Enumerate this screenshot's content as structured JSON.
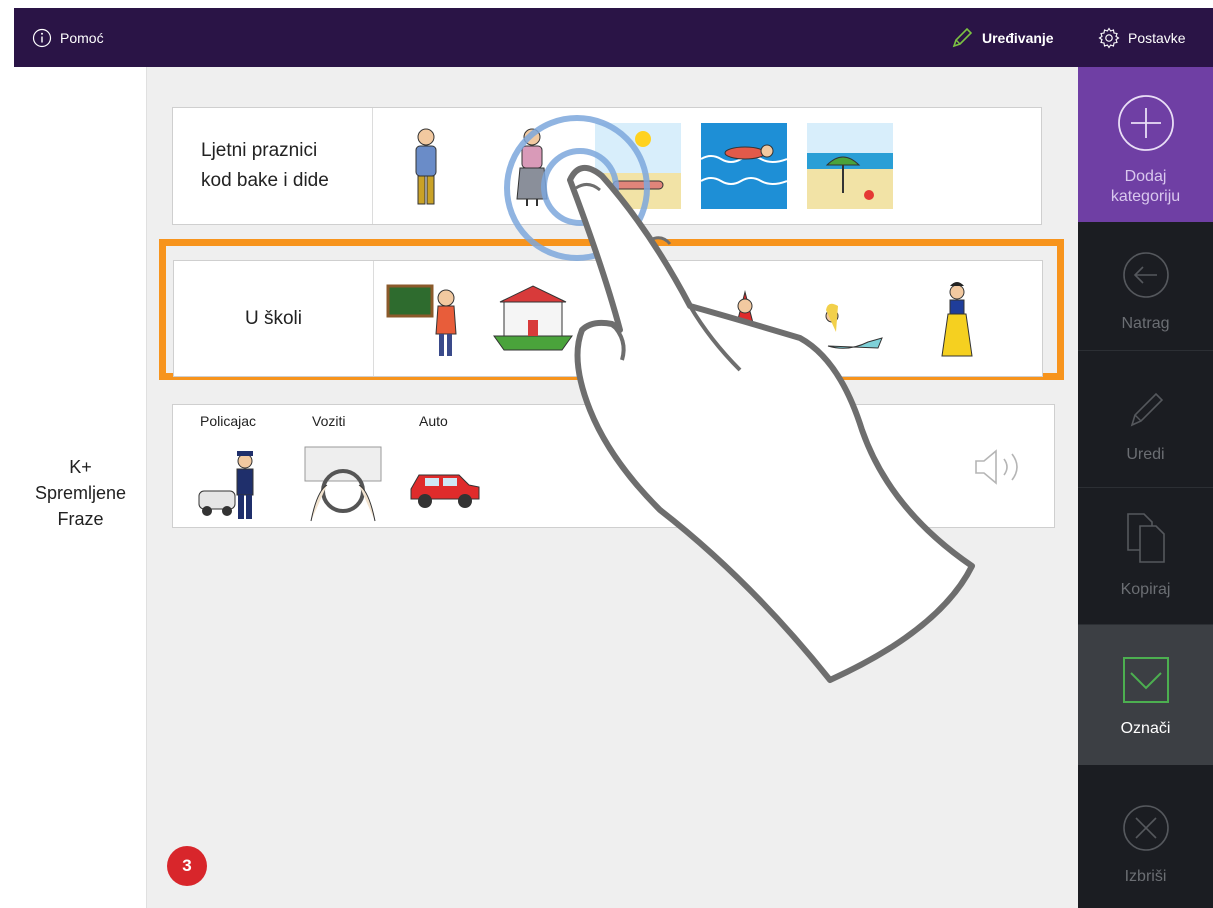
{
  "topbar": {
    "help_label": "Pomoć",
    "edit_label": "Uređivanje",
    "settings_label": "Postavke"
  },
  "left_panel": {
    "label_line1": "K+",
    "label_line2": "Spremljene",
    "label_line3": "Fraze"
  },
  "categories": [
    {
      "title_line1": "Ljetni praznici",
      "title_line2": "kod bake i dide",
      "pictograms": [
        "grandfather",
        "grandmother",
        "sunbathing",
        "swimming",
        "beach"
      ]
    },
    {
      "title": "U školi",
      "selected": true,
      "pictograms": [
        "teacher",
        "school",
        "frog",
        "little-red-riding-hood",
        "mermaid",
        "snow-white"
      ]
    }
  ],
  "phrase": {
    "words": [
      "Policajac",
      "Voziti",
      "Auto"
    ],
    "pictograms": [
      "policeman",
      "drive",
      "car"
    ]
  },
  "sidebar": {
    "add_label_line1": "Dodaj",
    "add_label_line2": "kategoriju",
    "back_label": "Natrag",
    "edit_label": "Uredi",
    "copy_label": "Kopiraj",
    "mark_label": "Označi",
    "delete_label": "Izbriši"
  },
  "badge": "3",
  "colors": {
    "topbar": "#2a1446",
    "add_button": "#6f3fa4",
    "selection_border": "#f7941d",
    "mark_check": "#4caf50",
    "badge": "#d8262b"
  }
}
